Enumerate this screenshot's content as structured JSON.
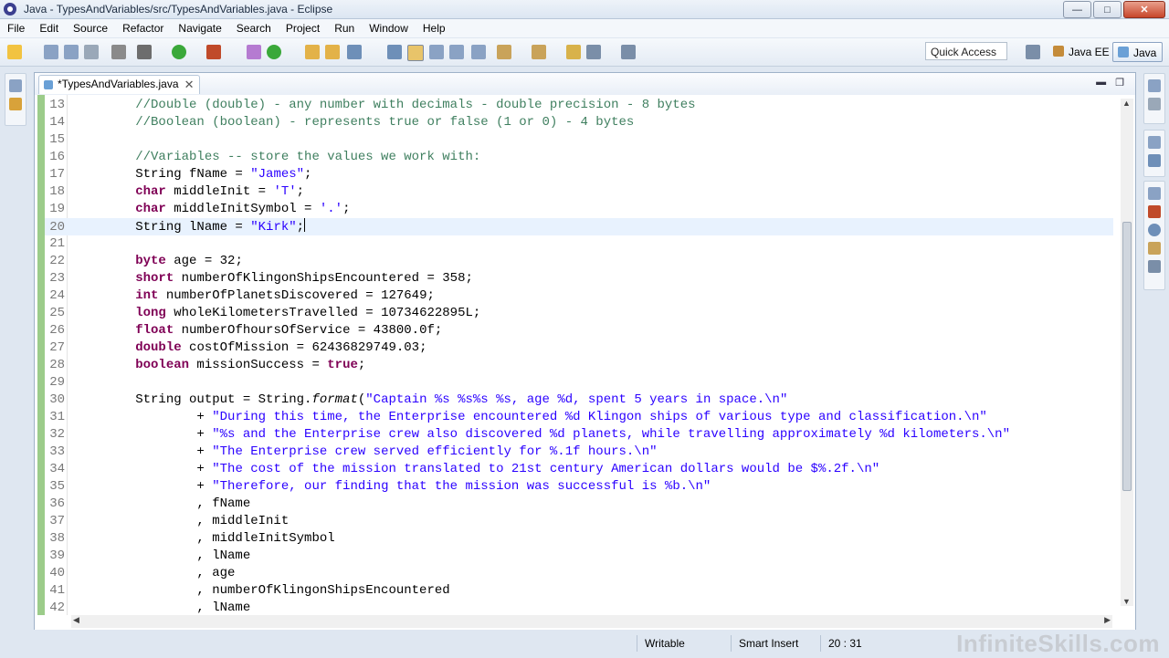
{
  "window": {
    "title": "Java - TypesAndVariables/src/TypesAndVariables.java - Eclipse"
  },
  "menu": [
    "File",
    "Edit",
    "Source",
    "Refactor",
    "Navigate",
    "Search",
    "Project",
    "Run",
    "Window",
    "Help"
  ],
  "toolbar": {
    "quick_access": "Quick Access",
    "perspectives": [
      "Java EE",
      "Java"
    ]
  },
  "editor": {
    "tab_label": "*TypesAndVariables.java",
    "lines": [
      {
        "n": "13",
        "t": [
          {
            "c": "cm",
            "v": "        //Double (double) - any number with decimals - double precision - 8 bytes"
          }
        ]
      },
      {
        "n": "14",
        "t": [
          {
            "c": "cm",
            "v": "        //Boolean (boolean) - represents true or false (1 or 0) - 4 bytes"
          }
        ]
      },
      {
        "n": "15",
        "t": []
      },
      {
        "n": "16",
        "t": [
          {
            "c": "cm",
            "v": "        //Variables -- store the values we work with:"
          }
        ]
      },
      {
        "n": "17",
        "t": [
          {
            "c": "",
            "v": "        String fName = "
          },
          {
            "c": "st",
            "v": "\"James\""
          },
          {
            "c": "",
            "v": ";"
          }
        ]
      },
      {
        "n": "18",
        "t": [
          {
            "c": "",
            "v": "        "
          },
          {
            "c": "kw",
            "v": "char"
          },
          {
            "c": "",
            "v": " middleInit = "
          },
          {
            "c": "st",
            "v": "'T'"
          },
          {
            "c": "",
            "v": ";"
          }
        ]
      },
      {
        "n": "19",
        "t": [
          {
            "c": "",
            "v": "        "
          },
          {
            "c": "kw",
            "v": "char"
          },
          {
            "c": "",
            "v": " middleInitSymbol = "
          },
          {
            "c": "st",
            "v": "'.'"
          },
          {
            "c": "",
            "v": ";"
          }
        ]
      },
      {
        "n": "20",
        "current": true,
        "t": [
          {
            "c": "",
            "v": "        String lName = "
          },
          {
            "c": "st",
            "v": "\"Kirk\""
          },
          {
            "c": "",
            "v": ";"
          },
          {
            "c": "caret",
            "v": ""
          }
        ]
      },
      {
        "n": "21",
        "t": []
      },
      {
        "n": "22",
        "t": [
          {
            "c": "",
            "v": "        "
          },
          {
            "c": "kw",
            "v": "byte"
          },
          {
            "c": "",
            "v": " age = 32;"
          }
        ]
      },
      {
        "n": "23",
        "t": [
          {
            "c": "",
            "v": "        "
          },
          {
            "c": "kw",
            "v": "short"
          },
          {
            "c": "",
            "v": " numberOfKlingonShipsEncountered = 358;"
          }
        ]
      },
      {
        "n": "24",
        "t": [
          {
            "c": "",
            "v": "        "
          },
          {
            "c": "kw",
            "v": "int"
          },
          {
            "c": "",
            "v": " numberOfPlanetsDiscovered = 127649;"
          }
        ]
      },
      {
        "n": "25",
        "t": [
          {
            "c": "",
            "v": "        "
          },
          {
            "c": "kw",
            "v": "long"
          },
          {
            "c": "",
            "v": " wholeKilometersTravelled = 10734622895L;"
          }
        ]
      },
      {
        "n": "26",
        "t": [
          {
            "c": "",
            "v": "        "
          },
          {
            "c": "kw",
            "v": "float"
          },
          {
            "c": "",
            "v": " numberOfhoursOfService = 43800.0f;"
          }
        ]
      },
      {
        "n": "27",
        "t": [
          {
            "c": "",
            "v": "        "
          },
          {
            "c": "kw",
            "v": "double"
          },
          {
            "c": "",
            "v": " costOfMission = 62436829749.03;"
          }
        ]
      },
      {
        "n": "28",
        "t": [
          {
            "c": "",
            "v": "        "
          },
          {
            "c": "kw",
            "v": "boolean"
          },
          {
            "c": "",
            "v": " missionSuccess = "
          },
          {
            "c": "kw",
            "v": "true"
          },
          {
            "c": "",
            "v": ";"
          }
        ]
      },
      {
        "n": "29",
        "t": []
      },
      {
        "n": "30",
        "t": [
          {
            "c": "",
            "v": "        String output = String."
          },
          {
            "c": "it",
            "v": "format"
          },
          {
            "c": "",
            "v": "("
          },
          {
            "c": "st",
            "v": "\"Captain %s %s%s %s, age %d, spent 5 years in space.\\n\""
          }
        ]
      },
      {
        "n": "31",
        "t": [
          {
            "c": "",
            "v": "                + "
          },
          {
            "c": "st",
            "v": "\"During this time, the Enterprise encountered %d Klingon ships of various type and classification.\\n\""
          }
        ]
      },
      {
        "n": "32",
        "t": [
          {
            "c": "",
            "v": "                + "
          },
          {
            "c": "st",
            "v": "\"%s and the Enterprise crew also discovered %d planets, while travelling approximately %d kilometers.\\n\""
          }
        ]
      },
      {
        "n": "33",
        "t": [
          {
            "c": "",
            "v": "                + "
          },
          {
            "c": "st",
            "v": "\"The Enterprise crew served efficiently for %.1f hours.\\n\""
          }
        ]
      },
      {
        "n": "34",
        "t": [
          {
            "c": "",
            "v": "                + "
          },
          {
            "c": "st",
            "v": "\"The cost of the mission translated to 21st century American dollars would be $%.2f.\\n\""
          }
        ]
      },
      {
        "n": "35",
        "t": [
          {
            "c": "",
            "v": "                + "
          },
          {
            "c": "st",
            "v": "\"Therefore, our finding that the mission was successful is %b.\\n\""
          }
        ]
      },
      {
        "n": "36",
        "t": [
          {
            "c": "",
            "v": "                , fName"
          }
        ]
      },
      {
        "n": "37",
        "t": [
          {
            "c": "",
            "v": "                , middleInit"
          }
        ]
      },
      {
        "n": "38",
        "t": [
          {
            "c": "",
            "v": "                , middleInitSymbol"
          }
        ]
      },
      {
        "n": "39",
        "t": [
          {
            "c": "",
            "v": "                , lName"
          }
        ]
      },
      {
        "n": "40",
        "t": [
          {
            "c": "",
            "v": "                , age"
          }
        ]
      },
      {
        "n": "41",
        "t": [
          {
            "c": "",
            "v": "                , numberOfKlingonShipsEncountered"
          }
        ]
      },
      {
        "n": "42",
        "t": [
          {
            "c": "",
            "v": "                , lName"
          }
        ]
      }
    ]
  },
  "status": {
    "writable": "Writable",
    "insert_mode": "Smart Insert",
    "position": "20 : 31"
  },
  "watermark": "InfiniteSkills.com",
  "colors": {
    "keyword": "#7f0055",
    "comment": "#3f7f5f",
    "string": "#2a00ff"
  }
}
